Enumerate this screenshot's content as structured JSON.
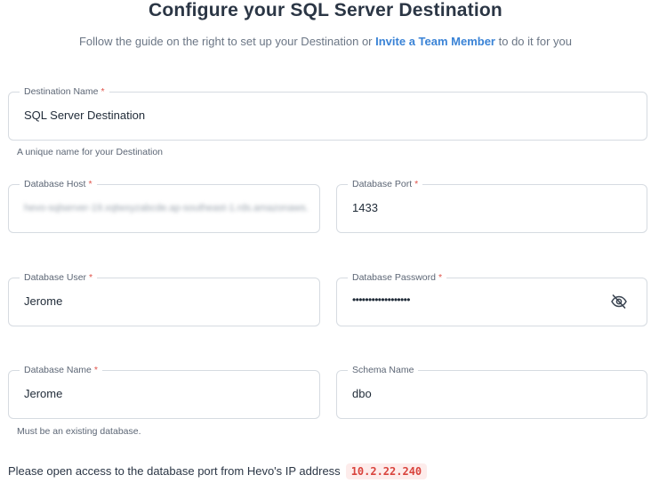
{
  "header": {
    "title": "Configure your SQL Server Destination",
    "subtitle_pre": "Follow the guide on the right to set up your Destination or ",
    "subtitle_link": "Invite a Team Member",
    "subtitle_post": " to do it for you"
  },
  "fields": {
    "destination_name": {
      "label": "Destination Name",
      "required": "*",
      "value": "SQL Server Destination",
      "hint": "A unique name for your Destination"
    },
    "database_host": {
      "label": "Database Host",
      "required": "*",
      "value": "hevo-sqlserver-19.xqtwxyzabcde.ap-southeast-1.rds.amazonaws.com"
    },
    "database_port": {
      "label": "Database Port",
      "required": "*",
      "value": "1433"
    },
    "database_user": {
      "label": "Database User",
      "required": "*",
      "value": "Jerome"
    },
    "database_password": {
      "label": "Database Password",
      "required": "*",
      "value": "••••••••••••••••••"
    },
    "database_name": {
      "label": "Database Name",
      "required": "*",
      "value": "Jerome",
      "hint": "Must be an existing database."
    },
    "schema_name": {
      "label": "Schema Name",
      "value": "dbo"
    }
  },
  "footer": {
    "text": "Please open access to the database port from Hevo's IP address",
    "ip": "10.2.22.240"
  },
  "icons": {
    "password_toggle": "eye-off-icon"
  },
  "colors": {
    "link": "#3a83d6",
    "required": "#e0534a",
    "ip_text": "#d9433c",
    "ip_bg": "#fdeceb"
  }
}
